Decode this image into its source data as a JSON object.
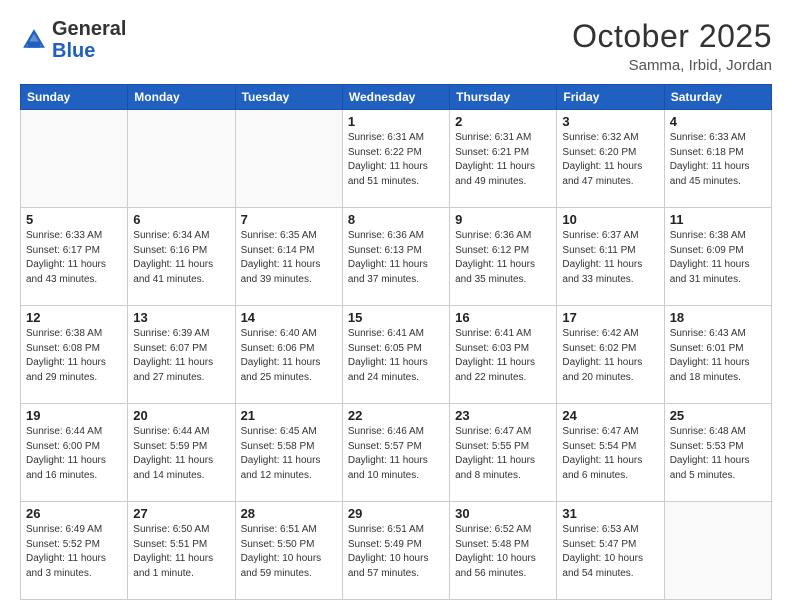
{
  "header": {
    "logo_general": "General",
    "logo_blue": "Blue",
    "month": "October 2025",
    "location": "Samma, Irbid, Jordan"
  },
  "weekdays": [
    "Sunday",
    "Monday",
    "Tuesday",
    "Wednesday",
    "Thursday",
    "Friday",
    "Saturday"
  ],
  "weeks": [
    [
      {
        "day": "",
        "info": ""
      },
      {
        "day": "",
        "info": ""
      },
      {
        "day": "",
        "info": ""
      },
      {
        "day": "1",
        "info": "Sunrise: 6:31 AM\nSunset: 6:22 PM\nDaylight: 11 hours\nand 51 minutes."
      },
      {
        "day": "2",
        "info": "Sunrise: 6:31 AM\nSunset: 6:21 PM\nDaylight: 11 hours\nand 49 minutes."
      },
      {
        "day": "3",
        "info": "Sunrise: 6:32 AM\nSunset: 6:20 PM\nDaylight: 11 hours\nand 47 minutes."
      },
      {
        "day": "4",
        "info": "Sunrise: 6:33 AM\nSunset: 6:18 PM\nDaylight: 11 hours\nand 45 minutes."
      }
    ],
    [
      {
        "day": "5",
        "info": "Sunrise: 6:33 AM\nSunset: 6:17 PM\nDaylight: 11 hours\nand 43 minutes."
      },
      {
        "day": "6",
        "info": "Sunrise: 6:34 AM\nSunset: 6:16 PM\nDaylight: 11 hours\nand 41 minutes."
      },
      {
        "day": "7",
        "info": "Sunrise: 6:35 AM\nSunset: 6:14 PM\nDaylight: 11 hours\nand 39 minutes."
      },
      {
        "day": "8",
        "info": "Sunrise: 6:36 AM\nSunset: 6:13 PM\nDaylight: 11 hours\nand 37 minutes."
      },
      {
        "day": "9",
        "info": "Sunrise: 6:36 AM\nSunset: 6:12 PM\nDaylight: 11 hours\nand 35 minutes."
      },
      {
        "day": "10",
        "info": "Sunrise: 6:37 AM\nSunset: 6:11 PM\nDaylight: 11 hours\nand 33 minutes."
      },
      {
        "day": "11",
        "info": "Sunrise: 6:38 AM\nSunset: 6:09 PM\nDaylight: 11 hours\nand 31 minutes."
      }
    ],
    [
      {
        "day": "12",
        "info": "Sunrise: 6:38 AM\nSunset: 6:08 PM\nDaylight: 11 hours\nand 29 minutes."
      },
      {
        "day": "13",
        "info": "Sunrise: 6:39 AM\nSunset: 6:07 PM\nDaylight: 11 hours\nand 27 minutes."
      },
      {
        "day": "14",
        "info": "Sunrise: 6:40 AM\nSunset: 6:06 PM\nDaylight: 11 hours\nand 25 minutes."
      },
      {
        "day": "15",
        "info": "Sunrise: 6:41 AM\nSunset: 6:05 PM\nDaylight: 11 hours\nand 24 minutes."
      },
      {
        "day": "16",
        "info": "Sunrise: 6:41 AM\nSunset: 6:03 PM\nDaylight: 11 hours\nand 22 minutes."
      },
      {
        "day": "17",
        "info": "Sunrise: 6:42 AM\nSunset: 6:02 PM\nDaylight: 11 hours\nand 20 minutes."
      },
      {
        "day": "18",
        "info": "Sunrise: 6:43 AM\nSunset: 6:01 PM\nDaylight: 11 hours\nand 18 minutes."
      }
    ],
    [
      {
        "day": "19",
        "info": "Sunrise: 6:44 AM\nSunset: 6:00 PM\nDaylight: 11 hours\nand 16 minutes."
      },
      {
        "day": "20",
        "info": "Sunrise: 6:44 AM\nSunset: 5:59 PM\nDaylight: 11 hours\nand 14 minutes."
      },
      {
        "day": "21",
        "info": "Sunrise: 6:45 AM\nSunset: 5:58 PM\nDaylight: 11 hours\nand 12 minutes."
      },
      {
        "day": "22",
        "info": "Sunrise: 6:46 AM\nSunset: 5:57 PM\nDaylight: 11 hours\nand 10 minutes."
      },
      {
        "day": "23",
        "info": "Sunrise: 6:47 AM\nSunset: 5:55 PM\nDaylight: 11 hours\nand 8 minutes."
      },
      {
        "day": "24",
        "info": "Sunrise: 6:47 AM\nSunset: 5:54 PM\nDaylight: 11 hours\nand 6 minutes."
      },
      {
        "day": "25",
        "info": "Sunrise: 6:48 AM\nSunset: 5:53 PM\nDaylight: 11 hours\nand 5 minutes."
      }
    ],
    [
      {
        "day": "26",
        "info": "Sunrise: 6:49 AM\nSunset: 5:52 PM\nDaylight: 11 hours\nand 3 minutes."
      },
      {
        "day": "27",
        "info": "Sunrise: 6:50 AM\nSunset: 5:51 PM\nDaylight: 11 hours\nand 1 minute."
      },
      {
        "day": "28",
        "info": "Sunrise: 6:51 AM\nSunset: 5:50 PM\nDaylight: 10 hours\nand 59 minutes."
      },
      {
        "day": "29",
        "info": "Sunrise: 6:51 AM\nSunset: 5:49 PM\nDaylight: 10 hours\nand 57 minutes."
      },
      {
        "day": "30",
        "info": "Sunrise: 6:52 AM\nSunset: 5:48 PM\nDaylight: 10 hours\nand 56 minutes."
      },
      {
        "day": "31",
        "info": "Sunrise: 6:53 AM\nSunset: 5:47 PM\nDaylight: 10 hours\nand 54 minutes."
      },
      {
        "day": "",
        "info": ""
      }
    ]
  ]
}
